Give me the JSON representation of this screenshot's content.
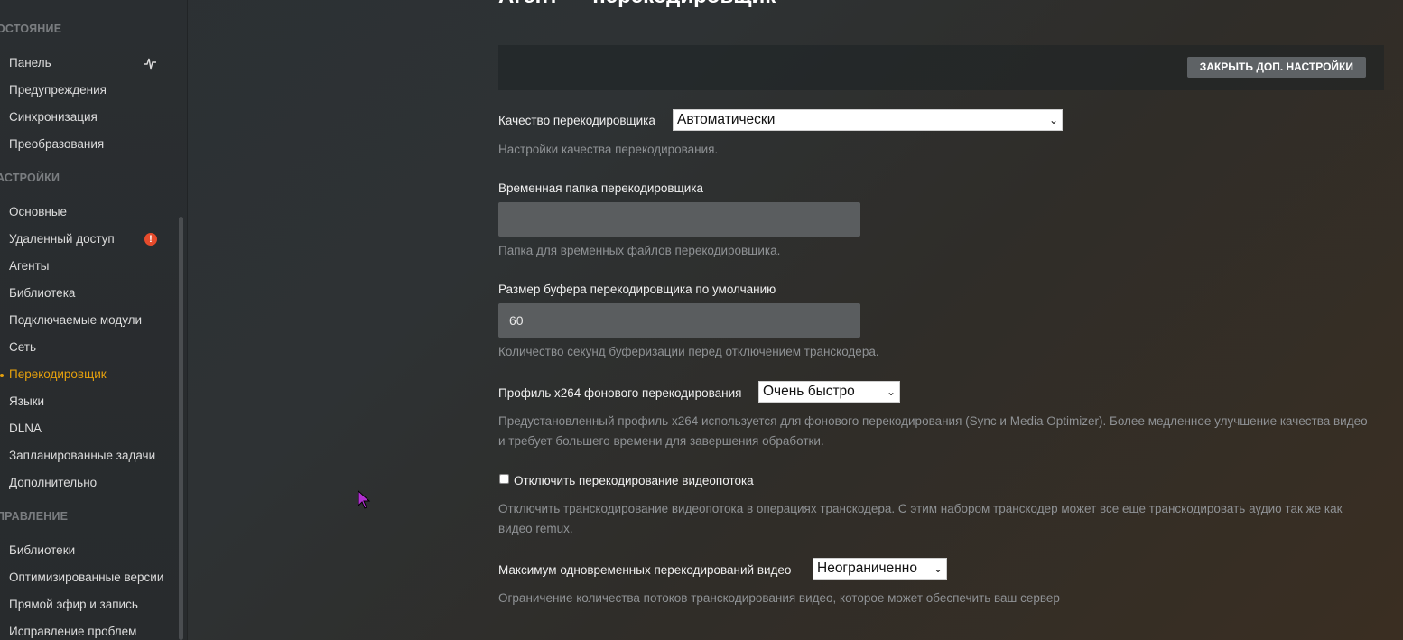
{
  "sidebar": {
    "sections": [
      {
        "title": "ОСТОЯНИЕ",
        "items": [
          "Панель",
          "Предупреждения",
          "Синхронизация",
          "Преобразования"
        ]
      },
      {
        "title": "АСТРОЙКИ",
        "items": [
          "Основные",
          "Удаленный доступ",
          "Агенты",
          "Библиотека",
          "Подключаемые модули",
          "Сеть",
          "Перекодировщик",
          "Языки",
          "DLNA",
          "Запланированные задачи",
          "Дополнительно"
        ]
      },
      {
        "title": "ПРАВЛЕНИЕ",
        "items": [
          "Библиотеки",
          "Оптимизированные версии",
          "Прямой эфир и запись",
          "Исправление проблем"
        ]
      }
    ],
    "active_item": "Перекодировщик",
    "warning_badge": "!",
    "colors": {
      "accent": "#e5a00d",
      "warning": "#e64b2c"
    }
  },
  "page": {
    "title": "Агент — перекодировщик",
    "advanced_button": "ЗАКРЫТЬ ДОП. НАСТРОЙКИ"
  },
  "settings": {
    "quality": {
      "label": "Качество перекодировщика",
      "value": "Автоматически",
      "help": "Настройки качества перекодирования."
    },
    "temp_folder": {
      "label": "Временная папка перекодировщика",
      "value": "",
      "help": "Папка для временных файлов перекодировщика."
    },
    "buffer": {
      "label": "Размер буфера перекодировщика по умолчанию",
      "value": "60",
      "help": "Количество секунд буферизации перед отключением транскодера."
    },
    "x264_profile": {
      "label": "Профиль x264 фонового перекодирования",
      "value": "Очень быстро",
      "help_line1": "Предустановленный профиль x264 используется для фонового перекодирования (Sync и Media Optimizer). Более медленное улучшение качества видео",
      "help_line2": "и требует большего времени для завершения обработки."
    },
    "disable_video": {
      "label": "Отключить перекодирование видеопотока",
      "checked": false,
      "help_line1": "Отключить транскодирование видеопотока в операциях транскодера. С этим набором транскодер может все еще транскодировать аудио так же как",
      "help_line2": "видео remux."
    },
    "max_transcodes": {
      "label": "Максимум одновременных перекодирований видео",
      "value": "Неограниченно",
      "help": "Ограничение количества потоков транскодирования видео, которое может обеспечить ваш сервер"
    }
  }
}
